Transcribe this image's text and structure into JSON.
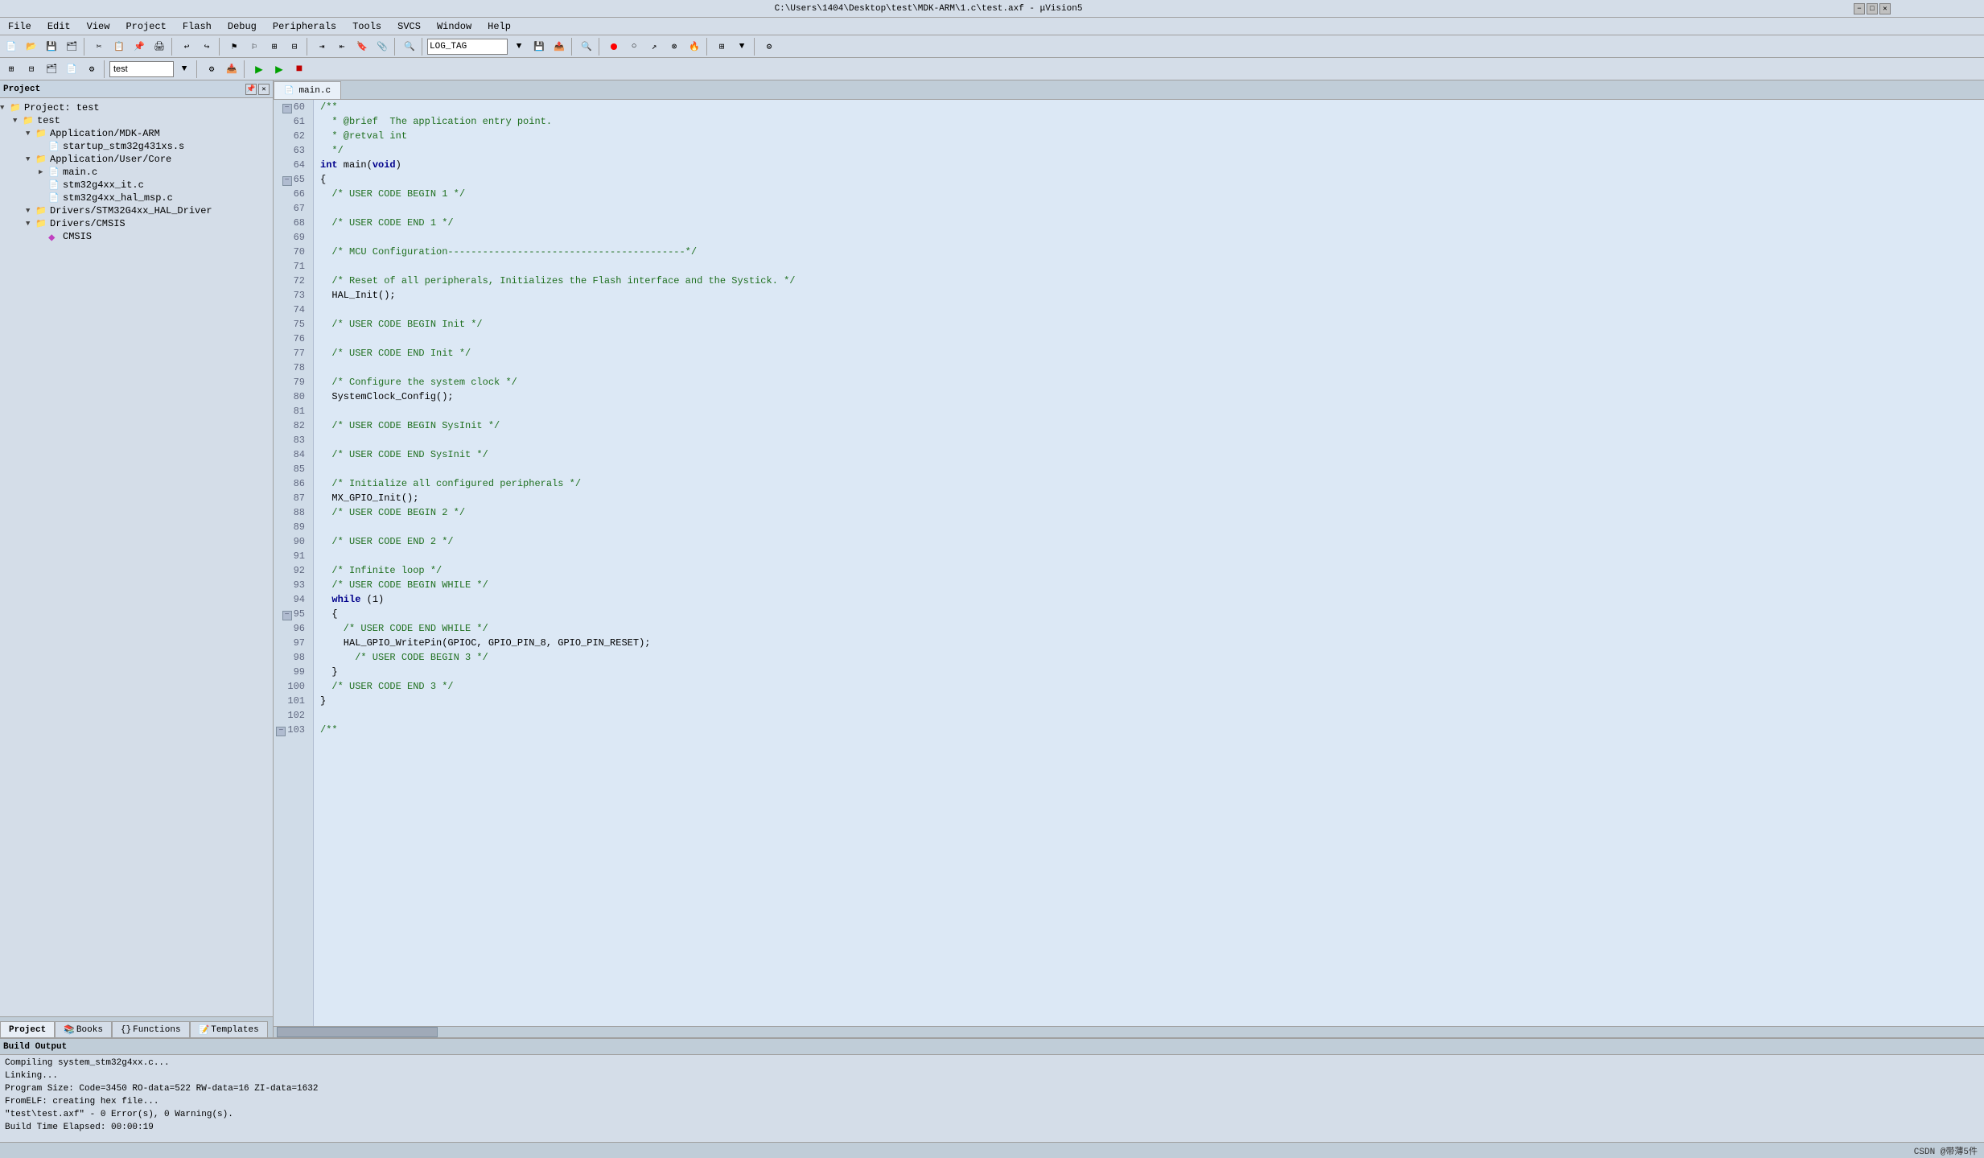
{
  "titlebar": {
    "text": "C:\\Users\\1404\\Desktop\\test\\MDK-ARM\\1.c\\test.axf - μVision5",
    "minimize": "−",
    "maximize": "□",
    "close": "✕"
  },
  "menubar": {
    "items": [
      "File",
      "Edit",
      "View",
      "Project",
      "Flash",
      "Debug",
      "Peripherals",
      "Tools",
      "SVCS",
      "Window",
      "Help"
    ]
  },
  "toolbar1": {
    "log_tag": "LOG_TAG"
  },
  "toolbar2": {
    "target": "test"
  },
  "leftpanel": {
    "title": "Project",
    "tree": [
      {
        "indent": 0,
        "arrow": "▼",
        "icon": "folder",
        "label": "Project: test"
      },
      {
        "indent": 1,
        "arrow": "▼",
        "icon": "folder",
        "label": "test"
      },
      {
        "indent": 2,
        "arrow": "▼",
        "icon": "folder",
        "label": "Application/MDK-ARM"
      },
      {
        "indent": 3,
        "arrow": "",
        "icon": "file",
        "label": "startup_stm32g431xs.s"
      },
      {
        "indent": 2,
        "arrow": "▼",
        "icon": "folder",
        "label": "Application/User/Core"
      },
      {
        "indent": 3,
        "arrow": "▶",
        "icon": "file",
        "label": "main.c"
      },
      {
        "indent": 3,
        "arrow": "",
        "icon": "file",
        "label": "stm32g4xx_it.c"
      },
      {
        "indent": 3,
        "arrow": "",
        "icon": "file",
        "label": "stm32g4xx_hal_msp.c"
      },
      {
        "indent": 2,
        "arrow": "▼",
        "icon": "folder",
        "label": "Drivers/STM32G4xx_HAL_Driver"
      },
      {
        "indent": 2,
        "arrow": "▼",
        "icon": "folder",
        "label": "Drivers/CMSIS"
      },
      {
        "indent": 3,
        "arrow": "",
        "icon": "diamond",
        "label": "CMSIS"
      }
    ],
    "tabs": [
      "Project",
      "Books",
      "Functions",
      "Templates"
    ]
  },
  "editor": {
    "tab": "main.c",
    "lines": [
      {
        "num": 60,
        "fold": true,
        "content": "/**",
        "class": "c-comment"
      },
      {
        "num": 61,
        "fold": false,
        "content": "  * @brief  The application entry point.",
        "class": "c-comment"
      },
      {
        "num": 62,
        "fold": false,
        "content": "  * @retval int",
        "class": "c-comment"
      },
      {
        "num": 63,
        "fold": false,
        "content": "  */",
        "class": "c-comment"
      },
      {
        "num": 64,
        "fold": false,
        "content": "int main(void)",
        "class": ""
      },
      {
        "num": 65,
        "fold": true,
        "content": "{",
        "class": ""
      },
      {
        "num": 66,
        "fold": false,
        "content": "  /* USER CODE BEGIN 1 */",
        "class": "c-comment"
      },
      {
        "num": 67,
        "fold": false,
        "content": "",
        "class": ""
      },
      {
        "num": 68,
        "fold": false,
        "content": "  /* USER CODE END 1 */",
        "class": "c-comment"
      },
      {
        "num": 69,
        "fold": false,
        "content": "",
        "class": ""
      },
      {
        "num": 70,
        "fold": false,
        "content": "  /* MCU Configuration-----------------------------------------*/",
        "class": "c-comment"
      },
      {
        "num": 71,
        "fold": false,
        "content": "",
        "class": ""
      },
      {
        "num": 72,
        "fold": false,
        "content": "  /* Reset of all peripherals, Initializes the Flash interface and the Systick. */",
        "class": "c-comment"
      },
      {
        "num": 73,
        "fold": false,
        "content": "  HAL_Init();",
        "class": ""
      },
      {
        "num": 74,
        "fold": false,
        "content": "",
        "class": ""
      },
      {
        "num": 75,
        "fold": false,
        "content": "  /* USER CODE BEGIN Init */",
        "class": "c-comment"
      },
      {
        "num": 76,
        "fold": false,
        "content": "",
        "class": ""
      },
      {
        "num": 77,
        "fold": false,
        "content": "  /* USER CODE END Init */",
        "class": "c-comment"
      },
      {
        "num": 78,
        "fold": false,
        "content": "",
        "class": ""
      },
      {
        "num": 79,
        "fold": false,
        "content": "  /* Configure the system clock */",
        "class": "c-comment"
      },
      {
        "num": 80,
        "fold": false,
        "content": "  SystemClock_Config();",
        "class": ""
      },
      {
        "num": 81,
        "fold": false,
        "content": "",
        "class": ""
      },
      {
        "num": 82,
        "fold": false,
        "content": "  /* USER CODE BEGIN SysInit */",
        "class": "c-comment"
      },
      {
        "num": 83,
        "fold": false,
        "content": "",
        "class": ""
      },
      {
        "num": 84,
        "fold": false,
        "content": "  /* USER CODE END SysInit */",
        "class": "c-comment"
      },
      {
        "num": 85,
        "fold": false,
        "content": "",
        "class": ""
      },
      {
        "num": 86,
        "fold": false,
        "content": "  /* Initialize all configured peripherals */",
        "class": "c-comment"
      },
      {
        "num": 87,
        "fold": false,
        "content": "  MX_GPIO_Init();",
        "class": ""
      },
      {
        "num": 88,
        "fold": false,
        "content": "  /* USER CODE BEGIN 2 */",
        "class": "c-comment"
      },
      {
        "num": 89,
        "fold": false,
        "content": "",
        "class": ""
      },
      {
        "num": 90,
        "fold": false,
        "content": "  /* USER CODE END 2 */",
        "class": "c-comment"
      },
      {
        "num": 91,
        "fold": false,
        "content": "",
        "class": ""
      },
      {
        "num": 92,
        "fold": false,
        "content": "  /* Infinite loop */",
        "class": "c-comment"
      },
      {
        "num": 93,
        "fold": false,
        "content": "  /* USER CODE BEGIN WHILE */",
        "class": "c-comment"
      },
      {
        "num": 94,
        "fold": false,
        "content": "  while (1)",
        "class": "keyword-line"
      },
      {
        "num": 95,
        "fold": true,
        "content": "  {",
        "class": ""
      },
      {
        "num": 96,
        "fold": false,
        "content": "    /* USER CODE END WHILE */",
        "class": "c-comment"
      },
      {
        "num": 97,
        "fold": false,
        "content": "    HAL_GPIO_WritePin(GPIOC, GPIO_PIN_8, GPIO_PIN_RESET);",
        "class": ""
      },
      {
        "num": 98,
        "fold": false,
        "content": "      /* USER CODE BEGIN 3 */",
        "class": "c-comment"
      },
      {
        "num": 99,
        "fold": false,
        "content": "  }",
        "class": ""
      },
      {
        "num": 100,
        "fold": false,
        "content": "  /* USER CODE END 3 */",
        "class": "c-comment"
      },
      {
        "num": 101,
        "fold": false,
        "content": "}",
        "class": ""
      },
      {
        "num": 102,
        "fold": false,
        "content": "",
        "class": ""
      },
      {
        "num": 103,
        "fold": true,
        "content": "/**",
        "class": "c-comment"
      }
    ]
  },
  "buildoutput": {
    "title": "Build Output",
    "lines": [
      "Compiling system_stm32g4xx.c...",
      "Linking...",
      "Program Size: Code=3450  RO-data=522  RW-data=16  ZI-data=1632",
      "FromELF: creating hex file...",
      "\"test\\test.axf\" - 0 Error(s), 0 Warning(s).",
      "Build Time Elapsed:  00:00:19"
    ]
  },
  "statusbar": {
    "text": "CSDN @带薄5件"
  }
}
